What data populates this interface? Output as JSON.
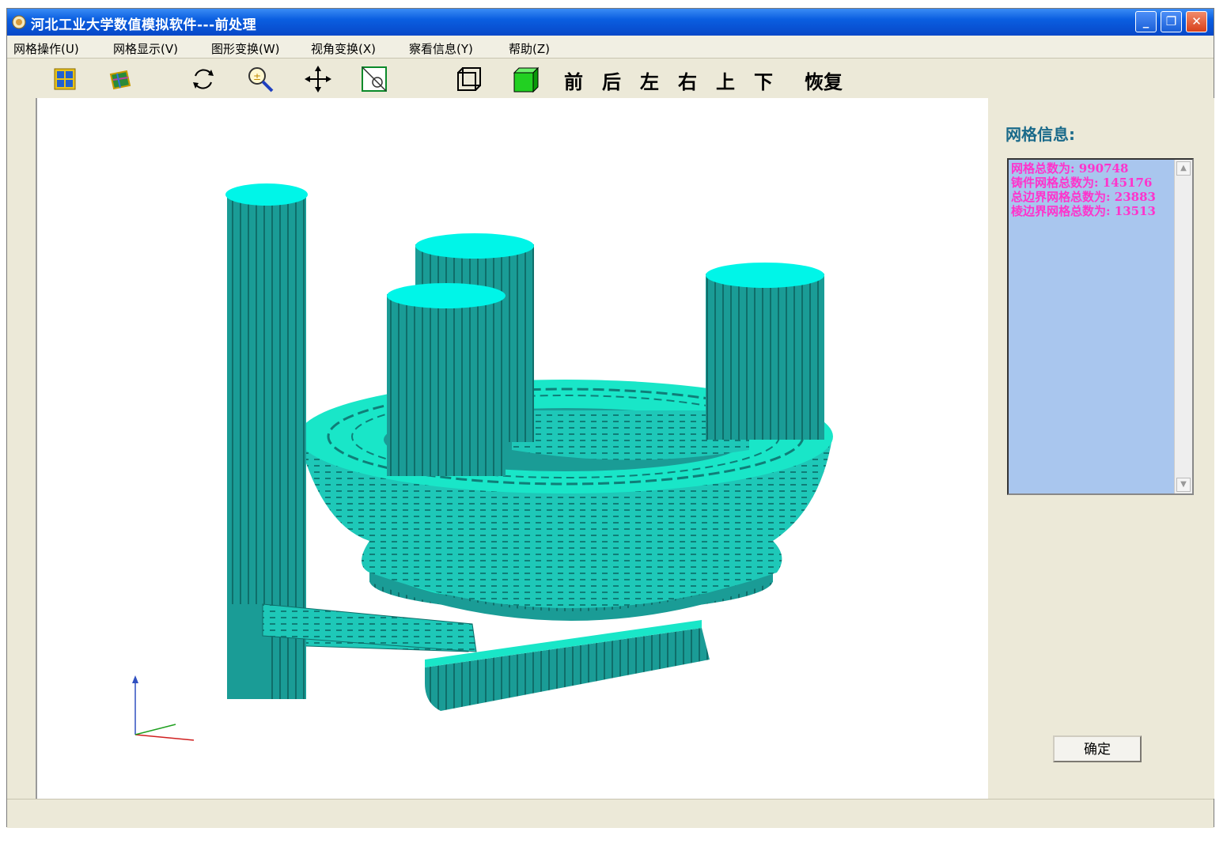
{
  "window": {
    "title": "河北工业大学数值模拟软件---前处理",
    "minimize": "_",
    "restore": "❐",
    "close": "✕"
  },
  "menu": [
    "网格操作(U)",
    "网格显示(V)",
    "图形变换(W)",
    "视角变换(X)",
    "察看信息(Y)",
    "帮助(Z)"
  ],
  "toolbar": {
    "icons": [
      "grid-view-icon",
      "mesh-layers-icon",
      "rotate-icon",
      "zoom-icon",
      "pan-icon",
      "select-icon",
      "wireframe-box-icon",
      "solid-box-icon"
    ],
    "views": [
      "前",
      "后",
      "左",
      "右",
      "上",
      "下"
    ],
    "reset": "恢复"
  },
  "colors": {
    "mesh_top": "#00f5e8",
    "mesh_side": "#1a9c96",
    "mesh_light": "#19e6c8",
    "info_bg": "#a9c6ee",
    "info_text": "#ff33cc"
  },
  "info_panel": {
    "title": "网格信息:",
    "lines": [
      "网格总数为: 990748",
      "铸件网格总数为: 145176",
      "总边界网格总数为: 23883",
      "棱边界网格总数为: 13513"
    ],
    "ok": "确定"
  }
}
